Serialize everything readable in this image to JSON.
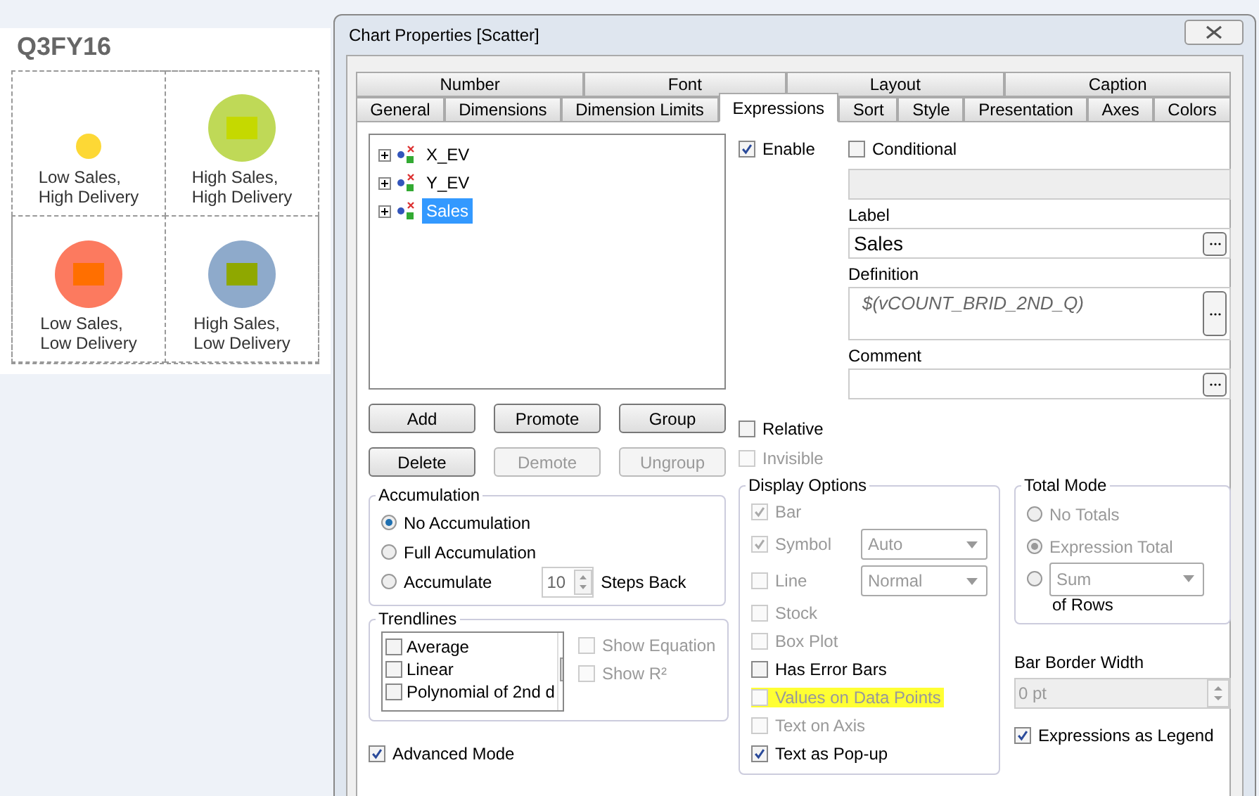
{
  "sheet_title": "Q3FY16",
  "quadrants": [
    {
      "label": "Low Sales,\nHigh Delivery",
      "kind": "dot",
      "color": "#fdd835"
    },
    {
      "label": "High Sales,\nHigh Delivery",
      "kind": "bubble",
      "color": "#bfd957",
      "marker": {
        "color": "#c5d900"
      }
    },
    {
      "label": "Low Sales,\nLow Delivery",
      "kind": "bubble",
      "color": "#fc7a5f",
      "marker": {
        "color": "#ff6f00"
      }
    },
    {
      "label": "High Sales,\nLow Delivery",
      "kind": "bubble",
      "color": "#8eaacb",
      "marker": {
        "color": "#8fa800"
      }
    }
  ],
  "dialog": {
    "title": "Chart Properties [Scatter]",
    "tab_rows": [
      [
        {
          "label": "Number",
          "selected": false
        },
        {
          "label": "Font",
          "selected": false
        },
        {
          "label": "Layout",
          "selected": false
        },
        {
          "label": "Caption",
          "selected": false
        }
      ],
      [
        {
          "label": "General",
          "selected": false
        },
        {
          "label": "Dimensions",
          "selected": false
        },
        {
          "label": "Dimension Limits",
          "selected": false
        },
        {
          "label": "Expressions",
          "selected": true
        },
        {
          "label": "Sort",
          "selected": false
        },
        {
          "label": "Style",
          "selected": false
        },
        {
          "label": "Presentation",
          "selected": false
        },
        {
          "label": "Axes",
          "selected": false
        },
        {
          "label": "Colors",
          "selected": false
        }
      ]
    ],
    "expressions": [
      {
        "label": "X_EV",
        "selected": false,
        "expanded": false
      },
      {
        "label": "Y_EV",
        "selected": false,
        "expanded": false
      },
      {
        "label": "Sales",
        "selected": true,
        "expanded": false
      }
    ],
    "buttons": [
      {
        "label": "Add",
        "disabled": false
      },
      {
        "label": "Promote",
        "disabled": false
      },
      {
        "label": "Group",
        "disabled": false
      },
      {
        "label": "Delete",
        "disabled": false
      },
      {
        "label": "Demote",
        "disabled": true
      },
      {
        "label": "Ungroup",
        "disabled": true
      }
    ],
    "accumulation": {
      "title": "Accumulation",
      "options": [
        {
          "label": "No Accumulation",
          "selected": true
        },
        {
          "label": "Full Accumulation",
          "selected": false
        },
        {
          "label": "Accumulate",
          "selected": false
        }
      ],
      "steps": "10",
      "steps_label": "Steps Back"
    },
    "trendlines": {
      "title": "Trendlines",
      "items": [
        {
          "label": "Average",
          "checked": false
        },
        {
          "label": "Linear",
          "checked": false
        },
        {
          "label": "Polynomial of 2nd d",
          "checked": false
        }
      ],
      "options": [
        {
          "label": "Show Equation",
          "checked": false,
          "disabled": true
        },
        {
          "label": "Show R²",
          "checked": false,
          "disabled": true
        }
      ]
    },
    "advanced_mode": {
      "label": "Advanced Mode",
      "checked": true
    },
    "enable": {
      "label": "Enable",
      "checked": true
    },
    "conditional": {
      "label": "Conditional",
      "checked": false
    },
    "label_field": {
      "label": "Label",
      "value": "Sales"
    },
    "definition_field": {
      "label": "Definition",
      "value": "$(vCOUNT_BRID_2ND_Q)"
    },
    "comment_field": {
      "label": "Comment"
    },
    "flags": [
      {
        "label": "Relative",
        "checked": false,
        "disabled": false
      },
      {
        "label": "Invisible",
        "checked": false,
        "disabled": true
      }
    ],
    "display_options": {
      "title": "Display Options",
      "items": [
        {
          "kind": "check",
          "label": "Bar",
          "checked": true,
          "disabled": true,
          "highlighted": false
        },
        {
          "kind": "check_select",
          "label": "Symbol",
          "checked": true,
          "disabled": true,
          "highlighted": false,
          "select": "Auto"
        },
        {
          "kind": "check_select",
          "label": "Line",
          "checked": false,
          "disabled": true,
          "highlighted": false,
          "select": "Normal"
        },
        {
          "kind": "check",
          "label": "Stock",
          "checked": false,
          "disabled": true,
          "highlighted": false
        },
        {
          "kind": "check",
          "label": "Box Plot",
          "checked": false,
          "disabled": true,
          "highlighted": false
        },
        {
          "kind": "check",
          "label": "Has Error Bars",
          "checked": false,
          "disabled": false,
          "highlighted": false
        },
        {
          "kind": "check",
          "label": "Values on Data Points",
          "checked": false,
          "disabled": true,
          "highlighted": true
        },
        {
          "kind": "check",
          "label": "Text on Axis",
          "checked": false,
          "disabled": true,
          "highlighted": false
        },
        {
          "kind": "check",
          "label": "Text as Pop-up",
          "checked": true,
          "disabled": false,
          "highlighted": false
        }
      ]
    },
    "total_mode": {
      "title": "Total Mode",
      "options": [
        {
          "kind": "radio",
          "label": "No Totals",
          "selected": false
        },
        {
          "kind": "radio",
          "label": "Expression Total",
          "selected": true
        },
        {
          "kind": "radio_select",
          "select": "Sum",
          "selected": false
        }
      ],
      "suffix": "of Rows"
    },
    "bar_border_width": {
      "label": "Bar Border Width",
      "value": "0 pt"
    },
    "expressions_as_legend": {
      "label": "Expressions as Legend",
      "checked": true
    }
  }
}
